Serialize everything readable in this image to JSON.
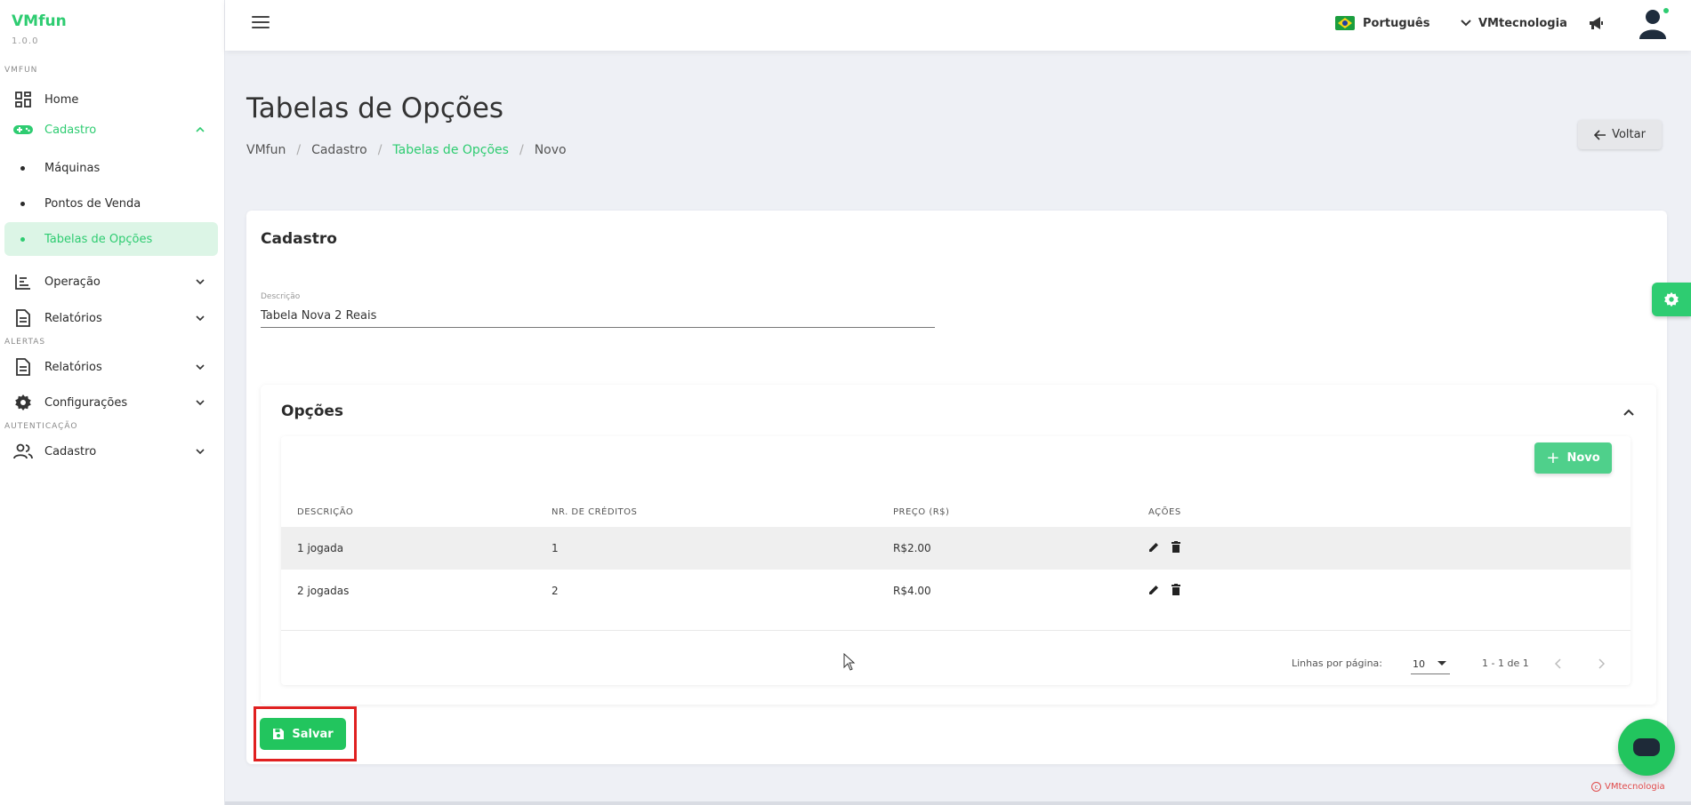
{
  "app": {
    "name": "VMfun",
    "version": "1.0.0"
  },
  "sidebar": {
    "sections": [
      "VMFUN",
      "ALERTAS",
      "AUTENTICAÇÃO"
    ],
    "items": [
      {
        "label": "Home",
        "icon": "dashboard-icon"
      },
      {
        "label": "Cadastro",
        "icon": "gamepad-icon",
        "expanded": true
      },
      {
        "label": "Máquinas"
      },
      {
        "label": "Pontos de Venda"
      },
      {
        "label": "Tabelas de Opções",
        "active": true
      },
      {
        "label": "Operação",
        "icon": "timeline-icon"
      },
      {
        "label": "Relatórios",
        "icon": "document-icon"
      },
      {
        "label": "Relatórios",
        "icon": "document-icon"
      },
      {
        "label": "Configurações",
        "icon": "gear-icon"
      },
      {
        "label": "Cadastro",
        "icon": "users-icon"
      }
    ]
  },
  "topbar": {
    "language": "Português",
    "company": "VMtecnologia"
  },
  "page": {
    "title": "Tabelas de Opções",
    "breadcrumb": [
      "VMfun",
      "Cadastro",
      "Tabelas de Opções",
      "Novo"
    ],
    "back_label": "Voltar"
  },
  "form": {
    "title": "Cadastro",
    "description_label": "Descrição",
    "description_value": "Tabela Nova 2 Reais",
    "save_label": "Salvar"
  },
  "options": {
    "title": "Opções",
    "new_label": "Novo",
    "columns": [
      "DESCRIÇÃO",
      "NR. DE CRÉDITOS",
      "PREÇO (R$)",
      "AÇÕES"
    ],
    "rows": [
      {
        "descricao": "1 jogada",
        "creditos": "1",
        "preco": "R$2.00"
      },
      {
        "descricao": "2 jogadas",
        "creditos": "2",
        "preco": "R$4.00"
      }
    ],
    "pagination": {
      "rows_per_page_label": "Linhas por página:",
      "rows_per_page": "10",
      "range": "1 - 1 de 1"
    }
  },
  "footer": {
    "credit": "VMtecnologia"
  },
  "colors": {
    "accent": "#2ecc71",
    "highlight": "#e02020"
  }
}
